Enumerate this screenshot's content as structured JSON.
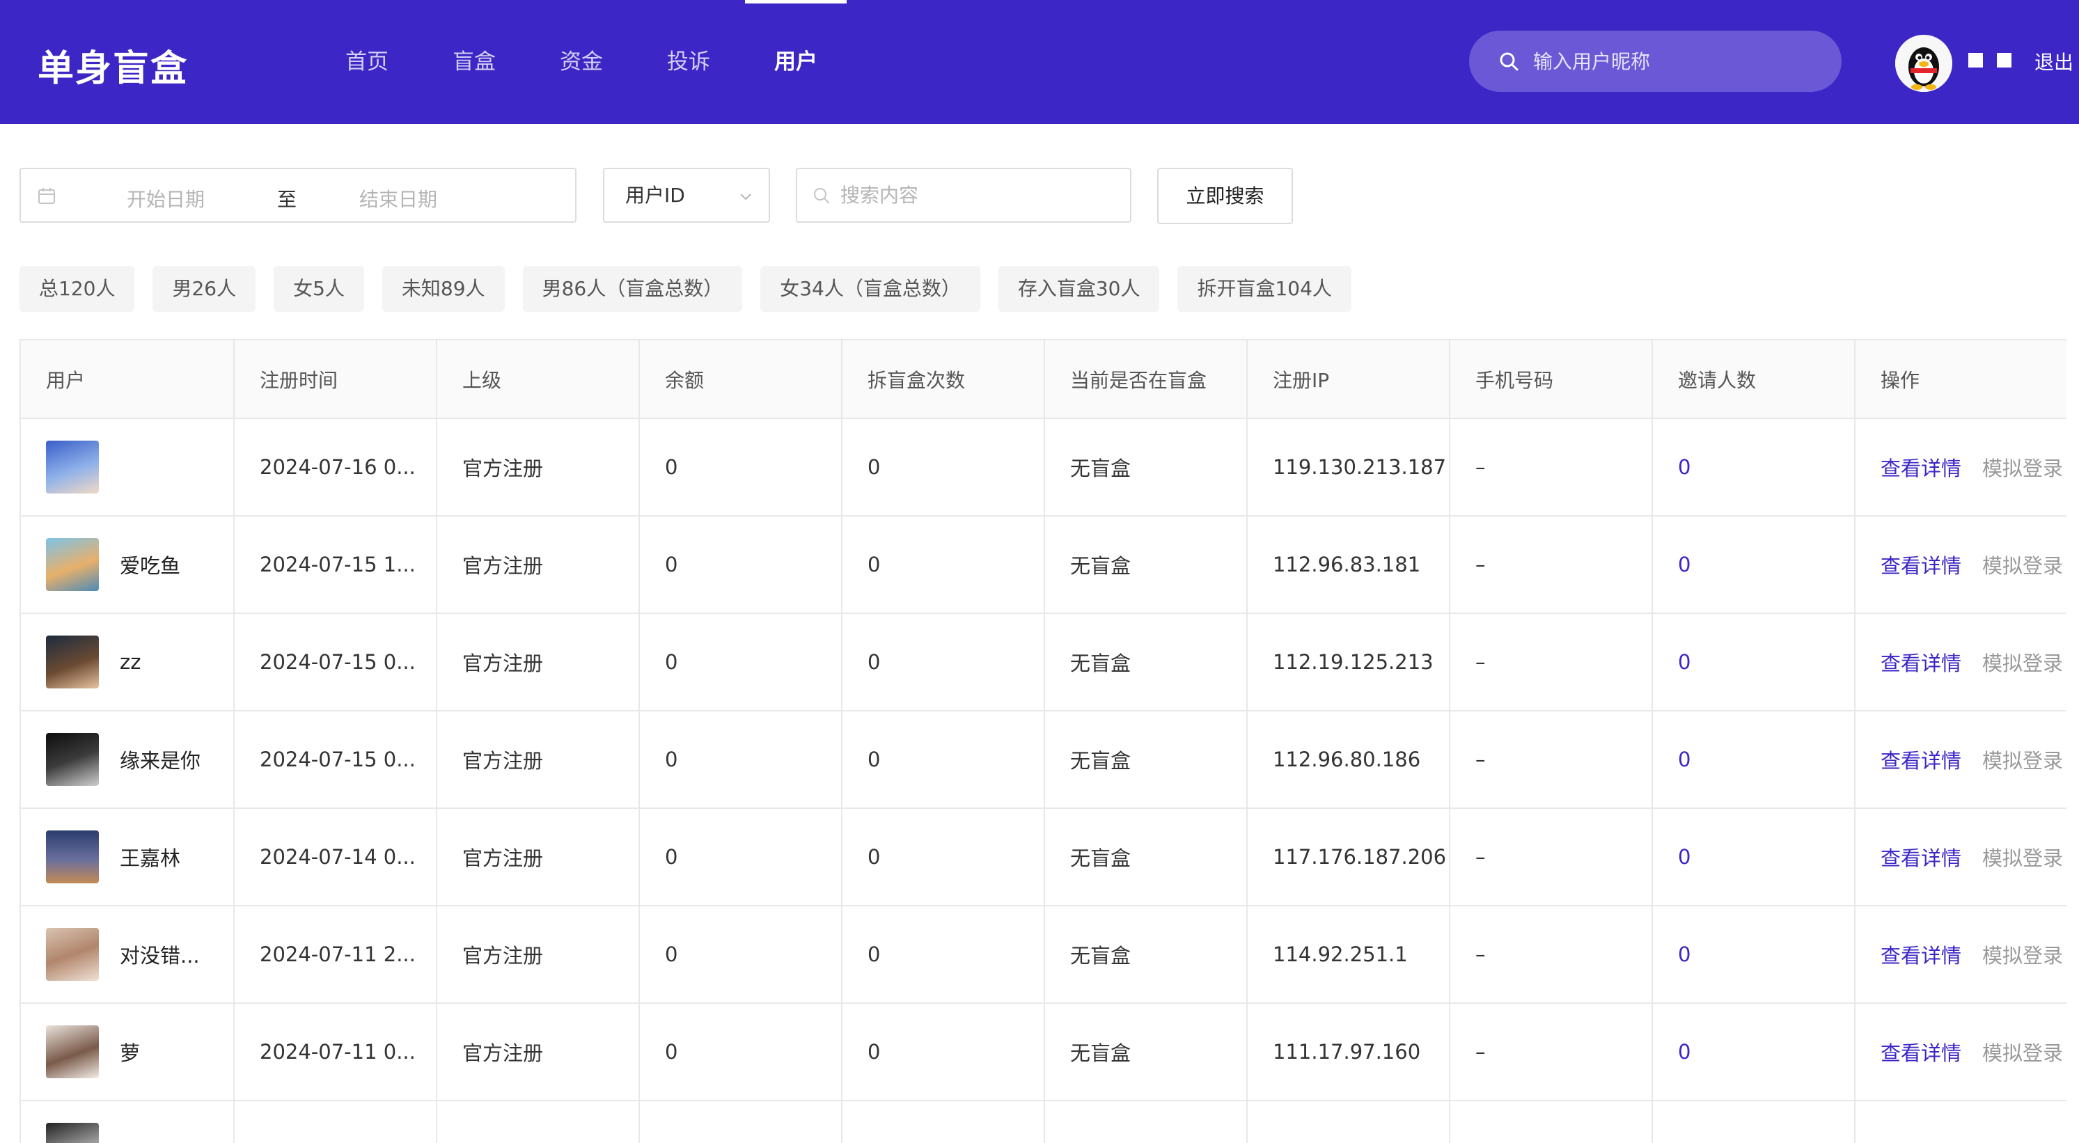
{
  "header": {
    "logo": "单身盲盒",
    "nav": [
      {
        "label": "首页",
        "active": false
      },
      {
        "label": "盲盒",
        "active": false
      },
      {
        "label": "资金",
        "active": false
      },
      {
        "label": "投诉",
        "active": false
      },
      {
        "label": "用户",
        "active": true
      }
    ],
    "search_placeholder": "输入用户昵称",
    "logout": "退出"
  },
  "filters": {
    "date_start_placeholder": "开始日期",
    "date_to": "至",
    "date_end_placeholder": "结束日期",
    "select_value": "用户ID",
    "search_placeholder": "搜索内容",
    "search_button": "立即搜索"
  },
  "stats": [
    "总120人",
    "男26人",
    "女5人",
    "未知89人",
    "男86人（盲盒总数）",
    "女34人（盲盒总数）",
    "存入盲盒30人",
    "拆开盲盒104人"
  ],
  "table": {
    "columns": [
      "用户",
      "注册时间",
      "上级",
      "余额",
      "拆盲盒次数",
      "当前是否在盲盒",
      "注册IP",
      "手机号码",
      "邀请人数",
      "操作"
    ],
    "actions": {
      "view": "查看详情",
      "login": "模拟登录"
    },
    "rows": [
      {
        "name": "",
        "time": "2024-07-16 0...",
        "parent": "官方注册",
        "balance": "0",
        "opens": "0",
        "in_box": "无盲盒",
        "ip": "119.130.213.187",
        "phone": "–",
        "invites": "0"
      },
      {
        "name": "爱吃鱼",
        "time": "2024-07-15 1...",
        "parent": "官方注册",
        "balance": "0",
        "opens": "0",
        "in_box": "无盲盒",
        "ip": "112.96.83.181",
        "phone": "–",
        "invites": "0"
      },
      {
        "name": "zz",
        "time": "2024-07-15 0...",
        "parent": "官方注册",
        "balance": "0",
        "opens": "0",
        "in_box": "无盲盒",
        "ip": "112.19.125.213",
        "phone": "–",
        "invites": "0"
      },
      {
        "name": "缘来是你",
        "time": "2024-07-15 0...",
        "parent": "官方注册",
        "balance": "0",
        "opens": "0",
        "in_box": "无盲盒",
        "ip": "112.96.80.186",
        "phone": "–",
        "invites": "0"
      },
      {
        "name": "王嘉林",
        "time": "2024-07-14 0...",
        "parent": "官方注册",
        "balance": "0",
        "opens": "0",
        "in_box": "无盲盒",
        "ip": "117.176.187.206",
        "phone": "–",
        "invites": "0"
      },
      {
        "name": "对没错...",
        "time": "2024-07-11 2...",
        "parent": "官方注册",
        "balance": "0",
        "opens": "0",
        "in_box": "无盲盒",
        "ip": "114.92.251.1",
        "phone": "–",
        "invites": "0"
      },
      {
        "name": "萝",
        "time": "2024-07-11 0...",
        "parent": "官方注册",
        "balance": "0",
        "opens": "0",
        "in_box": "无盲盒",
        "ip": "111.17.97.160",
        "phone": "–",
        "invites": "0"
      }
    ]
  },
  "colors": {
    "brand": "#3c26c6",
    "link": "#3c26c6",
    "muted": "#999999"
  }
}
